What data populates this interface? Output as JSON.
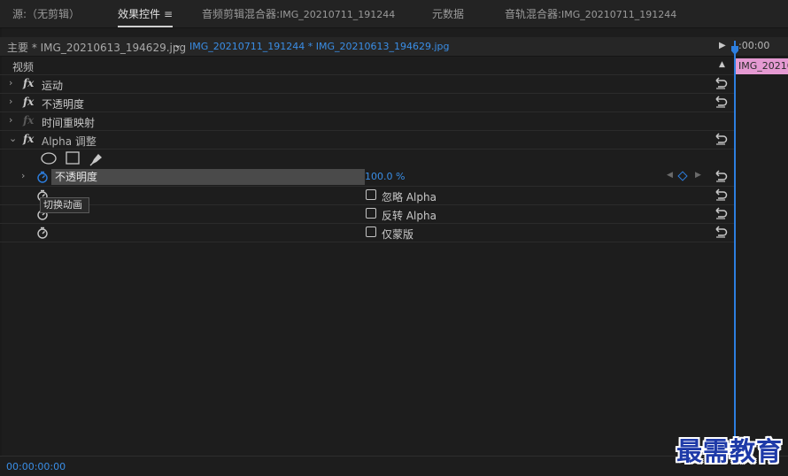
{
  "tabs": {
    "source": "源:（无剪辑）",
    "effect_controls": "效果控件",
    "effect_controls_menu": "≡",
    "audio_clip_mixer_label": "音频剪辑混合器:",
    "audio_clip_mixer_value": "IMG_20210711_191244",
    "metadata": "元数据",
    "audio_track_mixer_label": "音轨混合器:",
    "audio_track_mixer_value": "IMG_20210711_191244"
  },
  "clip_header": {
    "master": "主要 * IMG_20210613_194629.jpg",
    "chevron": "⌄",
    "sequence": "IMG_20210711_191244 * IMG_20210613_194629.jpg",
    "play": "▶"
  },
  "timeline": {
    "timecode": ":00:00",
    "clip_name": "IMG_20210",
    "clip_color": "#e59ad2",
    "playhead_color": "#2d7fe0"
  },
  "section": {
    "label": "视频",
    "collapse": "▲"
  },
  "effects": [
    {
      "name": "运动",
      "twisty": "›"
    },
    {
      "name": "不透明度",
      "twisty": "›"
    },
    {
      "name": "时间重映射",
      "twisty": "›"
    },
    {
      "name": "Alpha 调整",
      "twisty": "⌄"
    }
  ],
  "fx_label": "fx",
  "alpha": {
    "opacity_label": "不透明度",
    "opacity_value": "100.0 %",
    "ignore_alpha": "忽略 Alpha",
    "invert_alpha": "反转 Alpha",
    "mask_only": "仅蒙版",
    "twisty": "›"
  },
  "tooltip": "切换动画",
  "bottom": {
    "timecode": "00:00:00:00"
  },
  "watermark": "最需教育",
  "colors": {
    "accent": "#3a8ee6",
    "panel": "#1d1d1d"
  }
}
